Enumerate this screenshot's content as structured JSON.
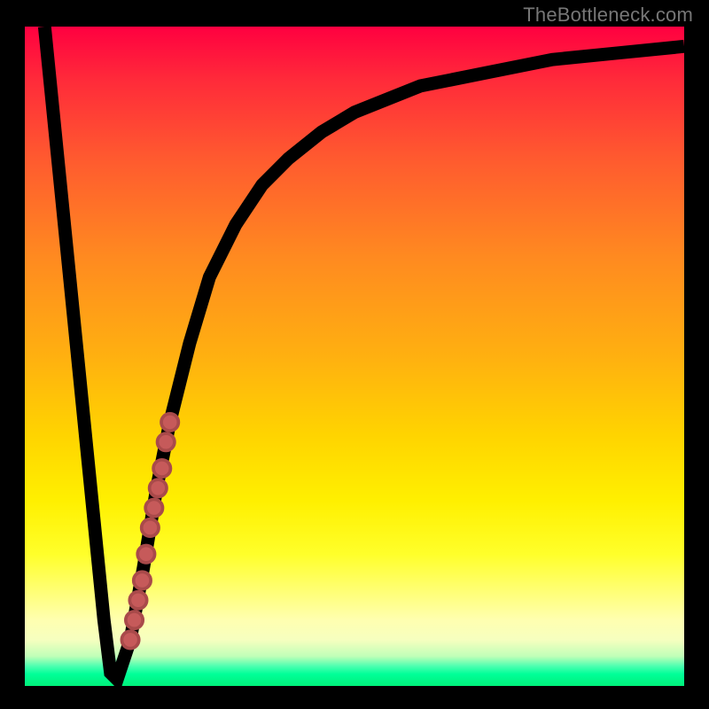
{
  "attribution": "TheBottleneck.com",
  "colors": {
    "frame_bg": "#000000",
    "curve": "#000000",
    "marker": "#c65a5a"
  },
  "chart_data": {
    "type": "line",
    "title": "",
    "xlabel": "",
    "ylabel": "",
    "xlim": [
      0,
      100
    ],
    "ylim": [
      0,
      100
    ],
    "grid": false,
    "legend": false,
    "series": [
      {
        "name": "bottleneck-curve",
        "x": [
          3,
          6,
          9,
          12,
          13,
          14,
          16,
          18,
          20,
          22,
          25,
          28,
          32,
          36,
          40,
          45,
          50,
          55,
          60,
          70,
          80,
          90,
          100
        ],
        "y": [
          100,
          70,
          40,
          10,
          2,
          1,
          7,
          18,
          30,
          40,
          52,
          62,
          70,
          76,
          80,
          84,
          87,
          89,
          91,
          93,
          95,
          96,
          97
        ]
      }
    ],
    "markers": {
      "name": "highlighted-range",
      "x": [
        16.0,
        16.6,
        17.2,
        17.8,
        18.4,
        19.0,
        19.6,
        20.2,
        20.8,
        21.4,
        22.0
      ],
      "y": [
        7.0,
        10.0,
        13.0,
        16.0,
        20.0,
        24.0,
        27.0,
        30.0,
        33.0,
        37.0,
        40.0
      ]
    },
    "background_gradient": {
      "direction": "vertical",
      "stops": [
        {
          "pos": 0.0,
          "color": "#ff0040"
        },
        {
          "pos": 0.35,
          "color": "#ff8a20"
        },
        {
          "pos": 0.62,
          "color": "#ffd400"
        },
        {
          "pos": 0.9,
          "color": "#ffffb0"
        },
        {
          "pos": 0.97,
          "color": "#4cffb0"
        },
        {
          "pos": 1.0,
          "color": "#00f07a"
        }
      ]
    }
  }
}
